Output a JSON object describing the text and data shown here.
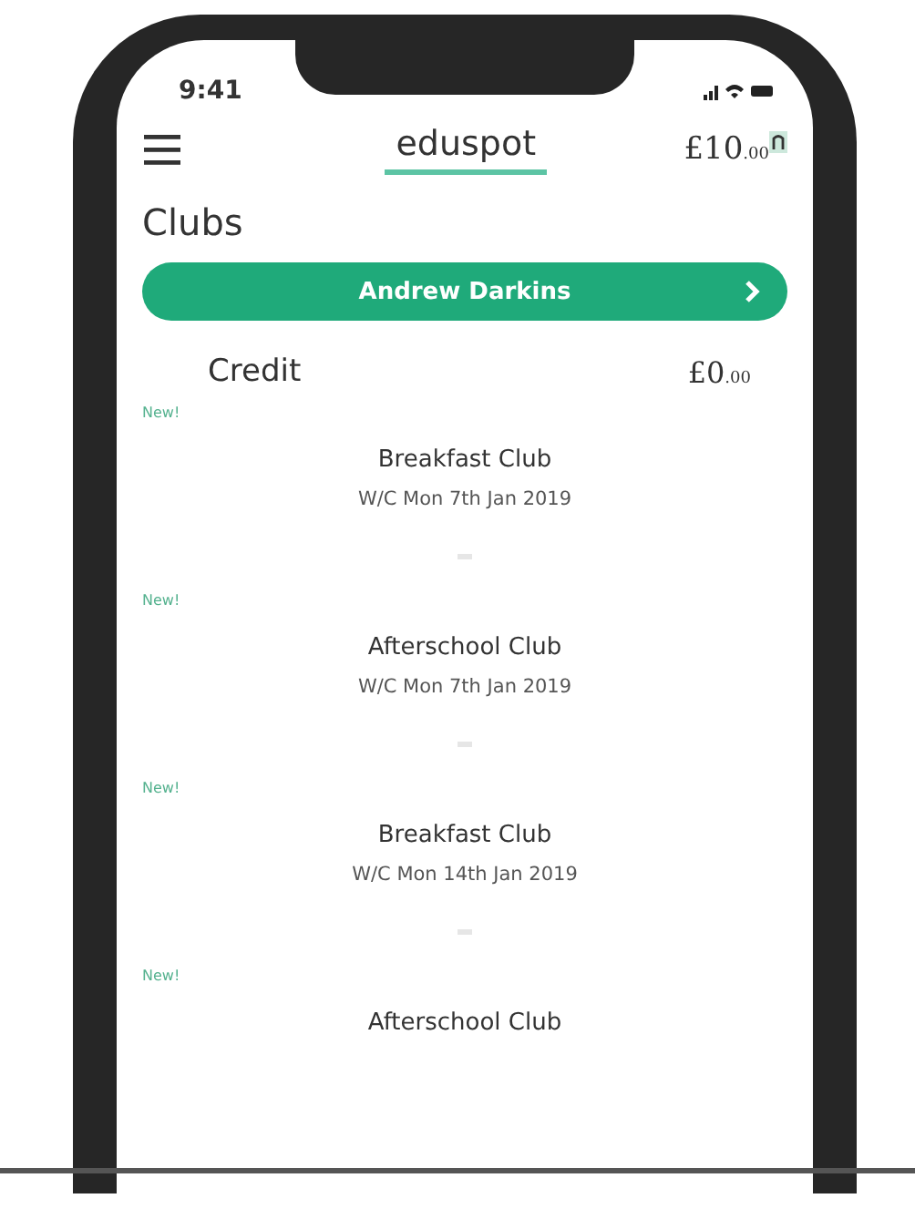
{
  "status_bar": {
    "time": "9:41"
  },
  "header": {
    "logo": "eduspot",
    "balance": {
      "main": "£10",
      "minor": ".00"
    }
  },
  "title": "Clubs",
  "student_button": {
    "label": "Andrew Darkins"
  },
  "credit": {
    "label": "Credit",
    "amount": {
      "main": "£0",
      "minor": ".00"
    }
  },
  "clubs": [
    {
      "badge": "New!",
      "name": "Breakfast Club",
      "week": "W/C Mon 7th Jan 2019"
    },
    {
      "badge": "New!",
      "name": "Afterschool Club",
      "week": "W/C Mon 7th Jan 2019"
    },
    {
      "badge": "New!",
      "name": "Breakfast Club",
      "week": "W/C Mon 14th Jan 2019"
    },
    {
      "badge": "New!",
      "name": "Afterschool Club"
    }
  ]
}
